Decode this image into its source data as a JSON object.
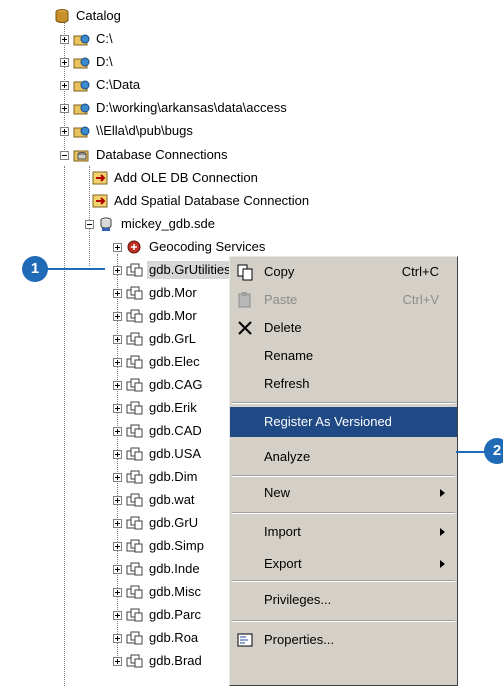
{
  "tree": {
    "root": "Catalog",
    "drives": [
      "C:\\",
      "D:\\",
      "C:\\Data",
      "D:\\working\\arkansas\\data\\access",
      "\\\\Ella\\d\\pub\\bugs"
    ],
    "db_connections": "Database Connections",
    "add_oledb": "Add OLE DB Connection",
    "add_spatial": "Add Spatial Database Connection",
    "sde": "mickey_gdb.sde",
    "geocoding": "Geocoding Services",
    "items": [
      "gdb.GrUtilities",
      "gdb.Mor",
      "gdb.Mor",
      "gdb.GrL",
      "gdb.Elec",
      "gdb.CAG",
      "gdb.Erik",
      "gdb.CAD",
      "gdb.USA",
      "gdb.Dim",
      "gdb.wat",
      "gdb.GrU",
      "gdb.Simp",
      "gdb.Inde",
      "gdb.Misc",
      "gdb.Parc",
      "gdb.Roa",
      "gdb.Brad"
    ]
  },
  "menu": {
    "copy": "Copy",
    "copy_key": "Ctrl+C",
    "paste": "Paste",
    "paste_key": "Ctrl+V",
    "delete": "Delete",
    "rename": "Rename",
    "refresh": "Refresh",
    "register": "Register As Versioned",
    "analyze": "Analyze",
    "new": "New",
    "import": "Import",
    "export": "Export",
    "privileges": "Privileges...",
    "properties": "Properties..."
  },
  "callouts": {
    "one": "1",
    "two": "2"
  },
  "colors": {
    "highlight": "#1f4a86",
    "callout": "#1f6bb8",
    "menu_bg": "#d4d0c8"
  }
}
